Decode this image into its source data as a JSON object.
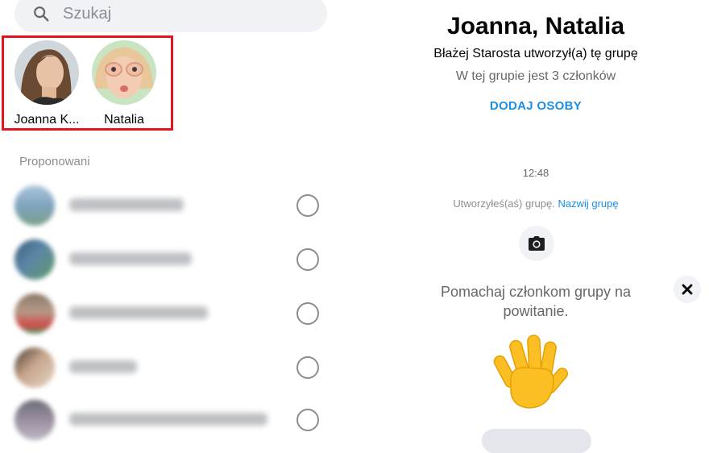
{
  "search": {
    "placeholder": "Szukaj"
  },
  "selected": [
    {
      "name": "Joanna K..."
    },
    {
      "name": "Natalia"
    }
  ],
  "suggestions": {
    "label": "Proponowani"
  },
  "group": {
    "title": "Joanna, Natalia",
    "created_by": "Błażej Starosta utworzył(a) tę grupę",
    "member_count": "W tej grupie jest 3 członków",
    "add_people": "DODAJ OSOBY"
  },
  "conversation": {
    "timestamp": "12:48",
    "created_notice": "Utworzyłeś(aś) grupę.",
    "name_group_link": "Nazwij grupę",
    "wave_prompt": "Pomachaj członkom grupy na powitanie."
  },
  "colors": {
    "accent": "#1a8fe3",
    "highlight_border": "#e5141d",
    "wave_emoji": "#fbbf24"
  },
  "icons": {
    "search": "search-icon",
    "camera": "camera-icon",
    "close": "close-icon",
    "wave": "waving-hand-icon"
  }
}
